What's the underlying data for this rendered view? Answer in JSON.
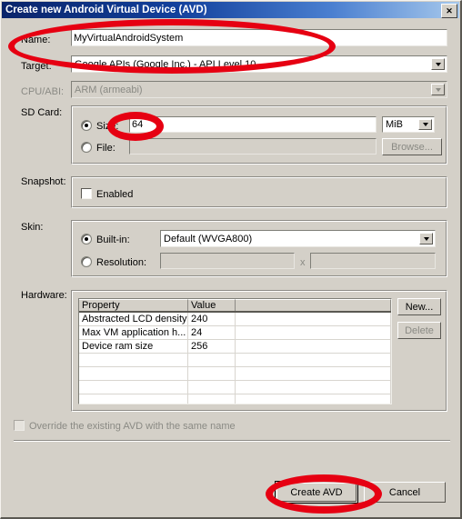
{
  "window": {
    "title": "Create new Android Virtual Device (AVD)",
    "close_label": "✕"
  },
  "form": {
    "name_label": "Name:",
    "name_value": "MyVirtualAndroidSystem",
    "target_label": "Target:",
    "target_value": "Google APIs (Google Inc.) - API Level 10",
    "cpu_label": "CPU/ABI:",
    "cpu_value": "ARM (armeabi)"
  },
  "sdcard": {
    "section_label": "SD Card:",
    "size_radio_label": "Size:",
    "size_value": "64",
    "size_unit": "MiB",
    "file_radio_label": "File:",
    "file_value": "",
    "browse_label": "Browse..."
  },
  "snapshot": {
    "section_label": "Snapshot:",
    "enabled_label": "Enabled"
  },
  "skin": {
    "section_label": "Skin:",
    "builtin_radio_label": "Built-in:",
    "builtin_value": "Default (WVGA800)",
    "resolution_radio_label": "Resolution:",
    "resolution_width": "",
    "resolution_x": "x",
    "resolution_height": ""
  },
  "hardware": {
    "section_label": "Hardware:",
    "columns": [
      "Property",
      "Value",
      ""
    ],
    "rows": [
      [
        "Abstracted LCD density",
        "240",
        ""
      ],
      [
        "Max VM application h...",
        "24",
        ""
      ],
      [
        "Device ram size",
        "256",
        ""
      ],
      [
        "",
        "",
        ""
      ],
      [
        "",
        "",
        ""
      ],
      [
        "",
        "",
        ""
      ],
      [
        "",
        "",
        ""
      ]
    ],
    "new_label": "New...",
    "delete_label": "Delete"
  },
  "override": {
    "label": "Override the existing AVD with the same name"
  },
  "footer": {
    "create_label": "Create AVD",
    "cancel_label": "Cancel"
  },
  "annotations": {
    "color": "#e60012",
    "marks": [
      "name-target-ellipse",
      "sdcard-size-ellipse",
      "create-avd-ellipse"
    ]
  }
}
